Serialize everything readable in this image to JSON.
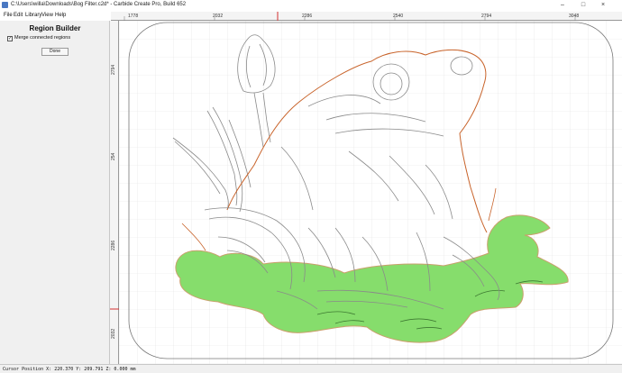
{
  "window": {
    "title": "C:\\Users\\willa\\Downloads\\Bog Filter.c2d* - Carbide Create Pro, Build 652",
    "minimize": "–",
    "maximize": "□",
    "close": "×"
  },
  "menu": [
    "File",
    "Edit",
    "Library",
    "View",
    "Help"
  ],
  "panel": {
    "title": "Region Builder",
    "merge_label": "Merge connected regions",
    "merge_checked": "✓",
    "done_label": "Done"
  },
  "ruler": {
    "top": [
      "1778",
      "2032",
      "2286",
      "2540",
      "2794",
      "3048"
    ],
    "left": [
      "2794",
      "254",
      "2286",
      "2032"
    ]
  },
  "status": {
    "cursor": "Cursor Position X: 220.370 Y: 209.791 Z: 0.000 mm"
  },
  "colors": {
    "lily_fill": "#86dd6c",
    "lily_stroke": "#c9a06c",
    "selection_stroke": "#c8632a",
    "grid": "#e2e2e2",
    "frog_line": "#8a8a8a"
  },
  "icons": {
    "app": "carbide-app-icon"
  }
}
